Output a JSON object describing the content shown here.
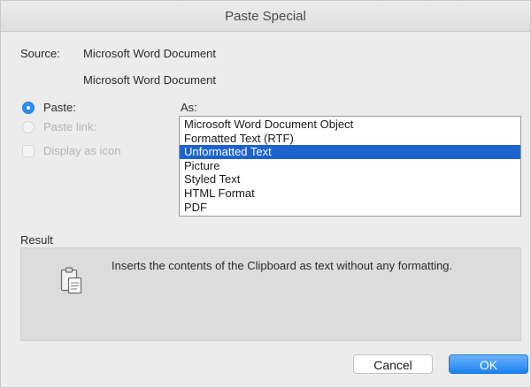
{
  "window": {
    "title": "Paste Special"
  },
  "source": {
    "label": "Source:",
    "value_line1": "Microsoft Word Document",
    "value_line2": "Microsoft Word Document"
  },
  "options": {
    "paste_label": "Paste:",
    "paste_selected": true,
    "paste_link_label": "Paste link:",
    "display_as_icon_label": "Display as icon"
  },
  "as_list": {
    "label": "As:",
    "items": [
      "Microsoft Word Document Object",
      "Formatted Text (RTF)",
      "Unformatted Text",
      "Picture",
      "Styled Text",
      "HTML Format",
      "PDF"
    ],
    "selected": "Unformatted Text"
  },
  "result": {
    "label": "Result",
    "description": "Inserts the contents of the Clipboard as text without any formatting.",
    "icon": "clipboard-icon"
  },
  "buttons": {
    "cancel": "Cancel",
    "ok": "OK"
  },
  "colors": {
    "selection": "#1d63cf",
    "accent": "#2e8ef4",
    "dialog_bg": "#ececec",
    "result_bg": "#dcdcdc"
  }
}
